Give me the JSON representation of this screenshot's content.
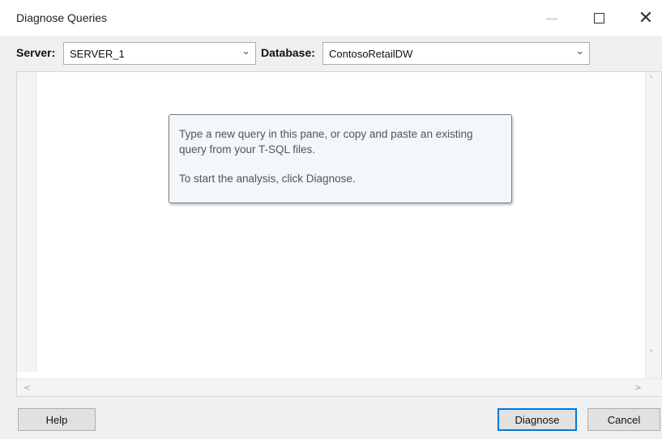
{
  "window": {
    "title": "Diagnose Queries",
    "controls": {
      "minimize_icon": "minimize-icon",
      "maximize_icon": "maximize-icon",
      "close_icon": "close-icon",
      "minimize_glyph": "—",
      "close_glyph": "✕"
    }
  },
  "toolbar": {
    "server_label": "Server:",
    "server_value": "SERVER_1",
    "database_label": "Database:",
    "database_value": "ContosoRetailDW",
    "dropdown_glyph": "⌄"
  },
  "editor": {
    "content": "",
    "hint_line1": "Type a new query in this pane, or copy and paste an existing query from your T-SQL files.",
    "hint_line2": "To start the analysis, click Diagnose.",
    "scroll_up_glyph": "˄",
    "scroll_down_glyph": "˅",
    "scroll_left_glyph": "<",
    "scroll_right_glyph": ">"
  },
  "buttons": {
    "help": "Help",
    "diagnose": "Diagnose",
    "cancel": "Cancel"
  },
  "colors": {
    "accent": "#0078d7",
    "window_bg": "#f0f0f0",
    "hint_border": "#7c7c7c"
  }
}
